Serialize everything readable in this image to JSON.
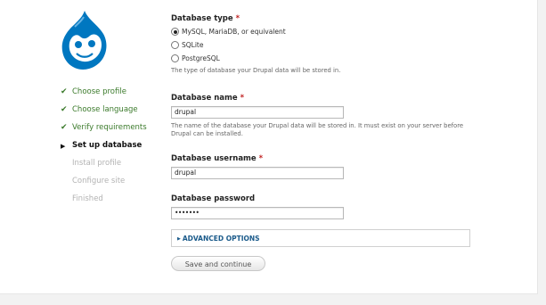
{
  "steps": [
    {
      "label": "Choose profile",
      "state": "done"
    },
    {
      "label": "Choose language",
      "state": "done"
    },
    {
      "label": "Verify requirements",
      "state": "done"
    },
    {
      "label": "Set up database",
      "state": "active"
    },
    {
      "label": "Install profile",
      "state": "pending"
    },
    {
      "label": "Configure site",
      "state": "pending"
    },
    {
      "label": "Finished",
      "state": "pending"
    }
  ],
  "form": {
    "db_type": {
      "label": "Database type",
      "required_mark": "*",
      "options": [
        "MySQL, MariaDB, or equivalent",
        "SQLite",
        "PostgreSQL"
      ],
      "selected": "MySQL, MariaDB, or equivalent",
      "description": "The type of database your Drupal data will be stored in."
    },
    "db_name": {
      "label": "Database name",
      "required_mark": "*",
      "value": "drupal",
      "description": "The name of the database your Drupal data will be stored in. It must exist on your server before Drupal can be installed."
    },
    "db_user": {
      "label": "Database username",
      "required_mark": "*",
      "value": "drupal"
    },
    "db_pass": {
      "label": "Database password",
      "value": "•••••••"
    }
  },
  "advanced_label": "ADVANCED OPTIONS",
  "submit_label": "Save and continue",
  "colors": {
    "logo_blue": "#0077c0",
    "done_green": "#3b7a2b",
    "required_red": "#c02020",
    "link_blue": "#1a5a8a"
  }
}
